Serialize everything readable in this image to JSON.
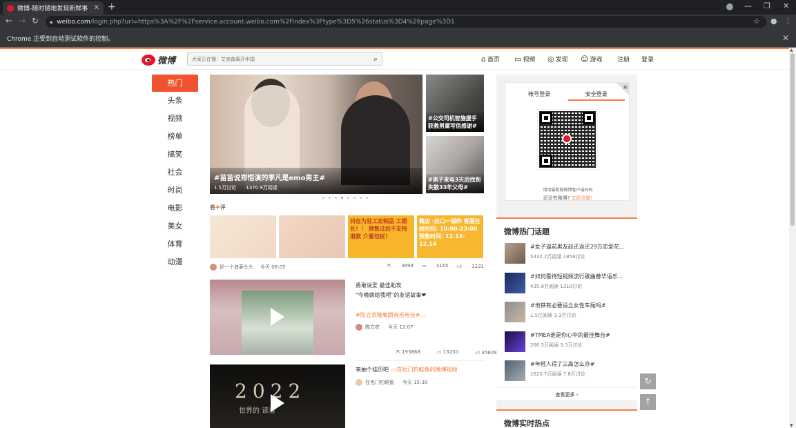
{
  "browser": {
    "tab_title": "微博-随时随地发现新鲜事",
    "url_host": "weibo.com",
    "url_path": "/login.php?url=https%3A%2F%2Fservice.account.weibo.com%2Findex%3Ftype%3D5%26status%3D4%26page%3D1",
    "automation_notice": "Chrome 正受到自动测试软件的控制。"
  },
  "header": {
    "logo_text": "微博",
    "search_placeholder": "大家正在搜：艾克森离开中国",
    "nav": [
      {
        "label": "首页",
        "icon": "home-icon"
      },
      {
        "label": "视频",
        "icon": "video-icon"
      },
      {
        "label": "发现",
        "icon": "compass-icon"
      },
      {
        "label": "游戏",
        "icon": "gamepad-icon"
      }
    ],
    "register": "注册",
    "login": "登录"
  },
  "categories": [
    "热门",
    "头条",
    "视频",
    "榜单",
    "搞笑",
    "社会",
    "时尚",
    "电影",
    "美女",
    "体育",
    "动漫"
  ],
  "active_category": "热门",
  "hero": {
    "title": "#苗苗说郑恺演的季凡是emo男主#",
    "discuss": "1.5万讨论",
    "reads": "1370.9万阅读"
  },
  "side_news": [
    {
      "caption": "#公交司机智施援手获救男童写信感谢#"
    },
    {
      "caption": "#男子来电3天后找到失散33年父母#"
    }
  ],
  "carousel": {
    "count": 8,
    "active": 3
  },
  "feed_section": {
    "prefix": "卷",
    "suffix": "评"
  },
  "thumbs": [
    {
      "text": ""
    },
    {
      "text": ""
    },
    {
      "text": "抖在为狂工定制品 工期长！！ 预售过后不支持退款 介意勿扰！"
    },
    {
      "text": "微店 :丝口一锅炸 客服在线时间: 10:00-23:00 预售时间: 12.12-12.14"
    }
  ],
  "post1": {
    "author": "好一个浪萝头头",
    "time": "今天 08:05",
    "shares": "3699",
    "comments": "3165",
    "likes": "1231"
  },
  "video1": {
    "title": "勇敢说爱 最佳助攻",
    "subtitle": "\"今晚嫁给我吧\"的友谊故事❤",
    "tag": "#陈立农隆离朗音乐电台#...",
    "author": "陈立农",
    "time": "今天 12:07",
    "shares": "193868",
    "comments": "13250",
    "likes": "356093"
  },
  "video2": {
    "title": "来抽个挂历吧",
    "link": "在也门钓鲑鱼的微博视频",
    "author": "在也门钓鲑鱼",
    "time": "今天 15:30",
    "cover_year": "2022",
    "cover_line": "世界的 读者"
  },
  "login_box": {
    "tab_account": "帐号登录",
    "tab_secure": "安全登录",
    "qr_hint": "请用最新版微博客户端扫码",
    "no_account": "还没有微博?",
    "register_link": "立即注册!"
  },
  "hot_topics": {
    "title": "微博热门话题",
    "items": [
      {
        "name": "#女子逼前男友赵还返还29万恋爱花...",
        "stats": "5432.2万阅读 1856讨论"
      },
      {
        "name": "#如何看待短视频流行歌曲替华语乐...",
        "stats": "435.8万阅读 1310讨论"
      },
      {
        "name": "#地铁有必要设立女性车厢吗#",
        "stats": "1.5亿阅读 3.3万讨论"
      },
      {
        "name": "#TMEA谁是你心中的最佳舞台#",
        "stats": "266.5万阅读 3.3万讨论"
      },
      {
        "name": "#年轻人得了三高怎么办#",
        "stats": "1620.7万阅读 7.8万讨论"
      }
    ],
    "more": "查看更多 ›"
  },
  "realtime": {
    "title": "微博实时热点"
  },
  "colors": {
    "accent": "#fa7d3c",
    "active_category": "#f0532f",
    "brand_red": "#e6162d"
  }
}
